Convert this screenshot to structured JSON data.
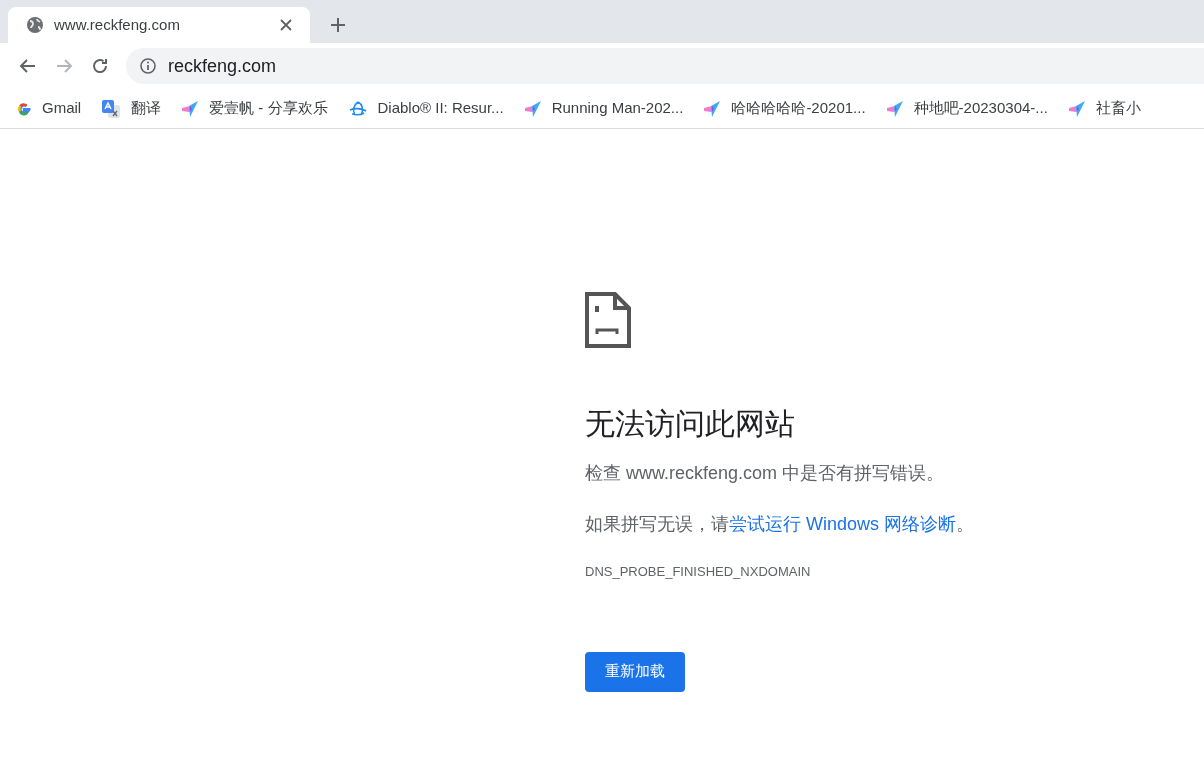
{
  "tabs": [
    {
      "title": "www.reckfeng.com",
      "selected": true
    }
  ],
  "toolbar": {
    "back_disabled": false,
    "forward_disabled": true,
    "address": "reckfeng.com"
  },
  "bookmarks": [
    {
      "kind": "gmail",
      "label": "Gmail"
    },
    {
      "kind": "translate",
      "label": "翻译"
    },
    {
      "kind": "site",
      "label": "爱壹帆 - 分享欢乐"
    },
    {
      "kind": "diablo",
      "label": "Diablo® II: Resur..."
    },
    {
      "kind": "site",
      "label": "Running Man-202..."
    },
    {
      "kind": "site",
      "label": "哈哈哈哈哈-20201..."
    },
    {
      "kind": "site",
      "label": "种地吧-20230304-..."
    },
    {
      "kind": "site",
      "label": "社畜小"
    }
  ],
  "error": {
    "heading": "无法访问此网站",
    "check_line": "检查 www.reckfeng.com 中是否有拼写错误。",
    "hint_before": "如果拼写无误，请",
    "hint_link": "尝试运行 Windows 网络诊断",
    "hint_after": "。",
    "code": "DNS_PROBE_FINISHED_NXDOMAIN",
    "reload_button": "重新加载"
  }
}
